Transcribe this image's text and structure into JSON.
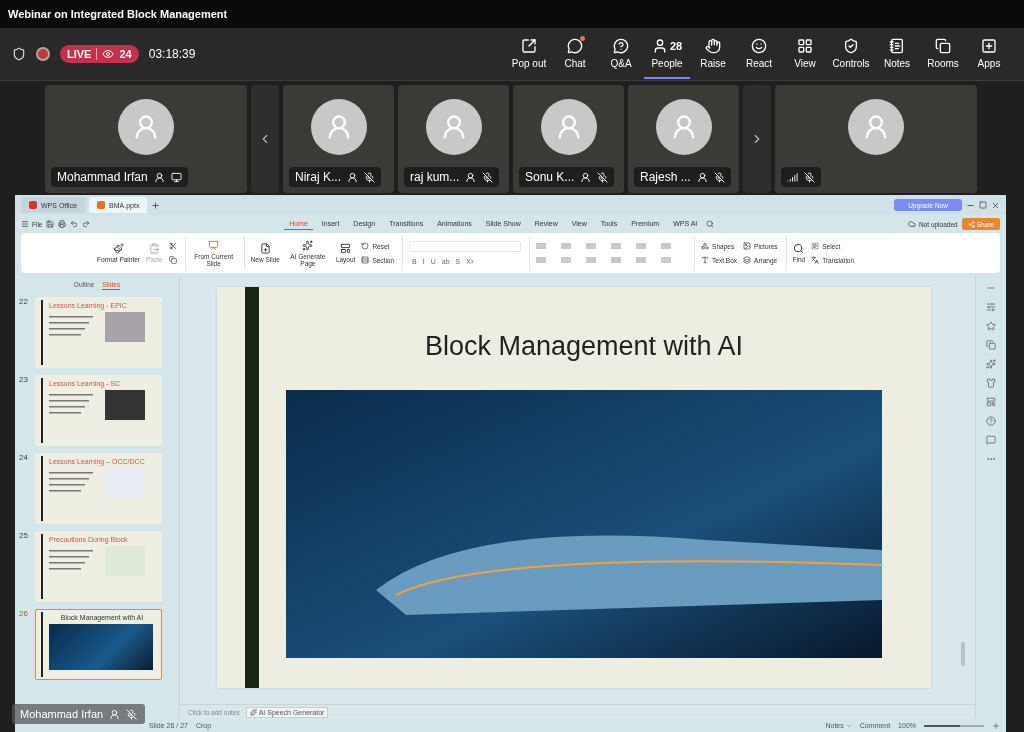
{
  "window": {
    "title": "Webinar on Integrated Block Management"
  },
  "meeting_bar": {
    "live_label": "LIVE",
    "viewers": "24",
    "elapsed": "03:18:39",
    "actions": [
      {
        "label": "Pop out",
        "selected": false,
        "unread": false
      },
      {
        "label": "Chat",
        "selected": false,
        "unread": true
      },
      {
        "label": "Q&A",
        "selected": false,
        "unread": false
      },
      {
        "label": "People",
        "count": "28",
        "selected": true,
        "unread": false
      },
      {
        "label": "Raise",
        "selected": false,
        "unread": false
      },
      {
        "label": "React",
        "selected": false,
        "unread": false
      },
      {
        "label": "View",
        "selected": false,
        "unread": false
      },
      {
        "label": "Controls",
        "selected": false,
        "unread": false
      },
      {
        "label": "Notes",
        "selected": false,
        "unread": false
      },
      {
        "label": "Rooms",
        "selected": false,
        "unread": false
      },
      {
        "label": "Apps",
        "selected": false,
        "unread": false
      }
    ]
  },
  "participants": [
    {
      "name": "Mohammad Irfan",
      "muted": false,
      "sharing": true,
      "kind": "wide"
    },
    {
      "kind": "prev"
    },
    {
      "name": "Niraj K...",
      "muted": true,
      "sharing": false,
      "kind": "tile"
    },
    {
      "name": "raj kum...",
      "muted": true,
      "sharing": false,
      "kind": "tile"
    },
    {
      "name": "Sonu K...",
      "muted": true,
      "sharing": false,
      "kind": "tile"
    },
    {
      "name": "Rajesh ...",
      "muted": true,
      "sharing": false,
      "kind": "tile"
    },
    {
      "kind": "next"
    },
    {
      "muted": true,
      "sharing": false,
      "kind": "wide"
    }
  ],
  "shared_screen": {
    "tabs": [
      {
        "label": "WPS Office",
        "selected": false
      },
      {
        "label": "BMA.pptx",
        "selected": true
      }
    ],
    "upgrade": "Upgrade Now",
    "file_menu": "File",
    "menu": [
      {
        "label": "Home",
        "selected": true
      },
      {
        "label": "Insert",
        "selected": false
      },
      {
        "label": "Design",
        "selected": false
      },
      {
        "label": "Transitions",
        "selected": false
      },
      {
        "label": "Animations",
        "selected": false
      },
      {
        "label": "Slide Show",
        "selected": false
      },
      {
        "label": "Review",
        "selected": false
      },
      {
        "label": "View",
        "selected": false
      },
      {
        "label": "Tools",
        "selected": false
      },
      {
        "label": "Premium",
        "selected": false
      },
      {
        "label": "WPS AI",
        "selected": false
      }
    ],
    "cloud_status": "Not uploaded",
    "share": "Share",
    "ribbon": {
      "clipboard": [
        {
          "label": "Format Painter",
          "disabled": false
        },
        {
          "label": "Paste",
          "disabled": true
        }
      ],
      "slide_show": "From Current Slide",
      "slides": [
        {
          "label": "New Slide",
          "kind": "large"
        },
        {
          "label": "AI Generate Page",
          "kind": "large"
        },
        {
          "label": "Layout",
          "kind": "large"
        },
        {
          "label": "Reset",
          "kind": "small"
        },
        {
          "label": "Section",
          "kind": "small"
        }
      ],
      "format_glyphs": [
        "B",
        "I",
        "U",
        "ab",
        "S",
        "X²"
      ],
      "drawing": [
        {
          "label": "Shapes"
        },
        {
          "label": "Pictures"
        },
        {
          "label": "Text Box"
        },
        {
          "label": "Arrange"
        }
      ],
      "editing": [
        {
          "label": "Find",
          "kind": "large"
        },
        {
          "label": "Select",
          "kind": "small"
        },
        {
          "label": "Translation",
          "kind": "small"
        }
      ]
    },
    "panel_tabs": [
      {
        "label": "Outline",
        "selected": false
      },
      {
        "label": "Slides",
        "selected": true
      }
    ],
    "slides": [
      {
        "number": "22",
        "title": "Lessons Learning - EPIC",
        "kind": "text-picture",
        "selected": false
      },
      {
        "number": "23",
        "title": "Lessons Learning - SC",
        "kind": "text-picture",
        "selected": false
      },
      {
        "number": "24",
        "title": "Lessons Learning – OCC/DCC",
        "kind": "text-picture",
        "selected": false
      },
      {
        "number": "25",
        "title": "Precautions During Block",
        "kind": "text-picture",
        "selected": false
      },
      {
        "number": "26",
        "title": "Block Management with AI",
        "kind": "title-picture",
        "selected": true
      }
    ],
    "current_slide": {
      "title": "Block Management with AI"
    },
    "notes_placeholder": "Click to add notes",
    "speech_button": "AI Speech Generator",
    "status": {
      "slide": "Slide 26 / 27",
      "crop": "Crop",
      "notes": "Notes",
      "comment": "Comment",
      "zoom": "100%",
      "zoom_level": {
        "level": 0.6
      }
    }
  },
  "presenter_tag": {
    "name": "Mohammad Irfan",
    "muted": true
  }
}
